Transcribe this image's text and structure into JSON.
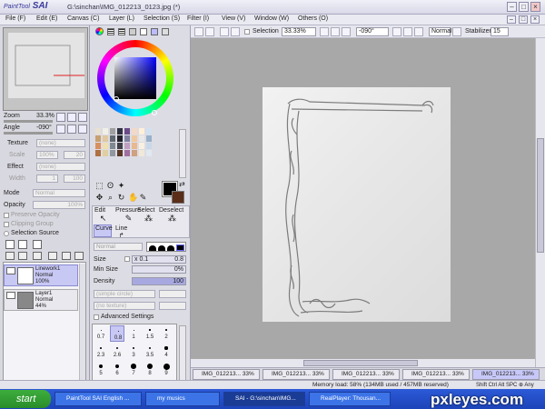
{
  "app": {
    "logo_small": "PaintTool",
    "logo": "SAI",
    "window_title": "G:\\sinchan\\IMG_012213_0123.jpg (*)"
  },
  "menu": [
    "File (F)",
    "Edit (E)",
    "Canvas (C)",
    "Layer (L)",
    "Selection (S)",
    "Filter (I)",
    "View (V)",
    "Window (W)",
    "Others (O)"
  ],
  "toolbar": {
    "selection_label": "Selection",
    "zoom": "33.33%",
    "angle": "-090°",
    "mode": "Normal",
    "stabilizer_label": "Stabilizer",
    "stabilizer": "15"
  },
  "navigator": {
    "zoom_label": "Zoom",
    "zoom_value": "33.3%",
    "angle_label": "Angle",
    "angle_value": "-090°"
  },
  "texture": {
    "label": "Texture",
    "value": "(none)",
    "scale_label": "Scale",
    "scale": "100%",
    "scale_num": "20"
  },
  "effect": {
    "label": "Effect",
    "value": "(none)",
    "width_label": "Width",
    "width": "1",
    "width_num": "100"
  },
  "layer_settings": {
    "mode_label": "Mode",
    "mode": "Normal",
    "opacity_label": "Opacity",
    "opacity": "100%",
    "preserve": "Preserve Opacity",
    "clipping": "Clipping Group",
    "selection_source": "Selection Source"
  },
  "layers": [
    {
      "name": "Linework1",
      "mode": "Normal",
      "opacity": "100%"
    },
    {
      "name": "Layer1",
      "mode": "Normal",
      "opacity": "44%"
    }
  ],
  "swatches": [
    "#e8e0d0",
    "#f0f0e8",
    "#a0a0a0",
    "#303040",
    "#6a4a88",
    "#f4d8c8",
    "#fff0d8",
    "#d0e0f0",
    "#c8a070",
    "#e0c8a0",
    "#606870",
    "#202028",
    "#8080a0",
    "#f0c8a0",
    "#e8e8e8",
    "#98b0c8",
    "#d89060",
    "#f0e0b0",
    "#808890",
    "#404048",
    "#c0a0c0",
    "#e8b890",
    "#f8f0e0",
    "#c8d8e8",
    "#b07040",
    "#e0d0a0",
    "#9098a0",
    "#5a3828",
    "#a070a0",
    "#d0a080",
    "#f0e8d8",
    "#e0e8f0"
  ],
  "color": {
    "primary": "#000000",
    "secondary": "#5a2e18"
  },
  "tool_mode": {
    "edit": "Edit",
    "pressure": "Pressure",
    "select": "Select",
    "deselect": "Deselect",
    "curve": "Curve",
    "line": "Line"
  },
  "brush": {
    "mode": "Normal",
    "size_label": "Size",
    "size_mult": "x 0.1",
    "size": "0.8",
    "min_size_label": "Min Size",
    "min_size": "0%",
    "density_label": "Density",
    "density": "100",
    "shape": "(simple circle)",
    "texture": "(no texture)",
    "advanced": "Advanced Settings"
  },
  "brush_sizes": [
    "0.7",
    "0.8",
    "1",
    "1.5",
    "2",
    "2.3",
    "2.6",
    "3",
    "3.5",
    "4",
    "5",
    "6",
    "7",
    "8",
    "9"
  ],
  "tabs": [
    "IMG_012213...",
    "IMG_012213...",
    "IMG_012213...",
    "IMG_012213...",
    "IMG_012213..."
  ],
  "tab_zoom": "33%",
  "status": {
    "memory": "Memory load: 58% (134MB used / 457MB reserved)",
    "keys": "Shift Ctrl Alt SPC ⊕ Any"
  },
  "taskbar": {
    "start": "start",
    "items": [
      "PaintTool SAI English ...",
      "my musics",
      "SAI - G:\\sinchan\\IMG...",
      "RealPlayer: Thousan..."
    ]
  },
  "watermark": "pxleyes.com"
}
